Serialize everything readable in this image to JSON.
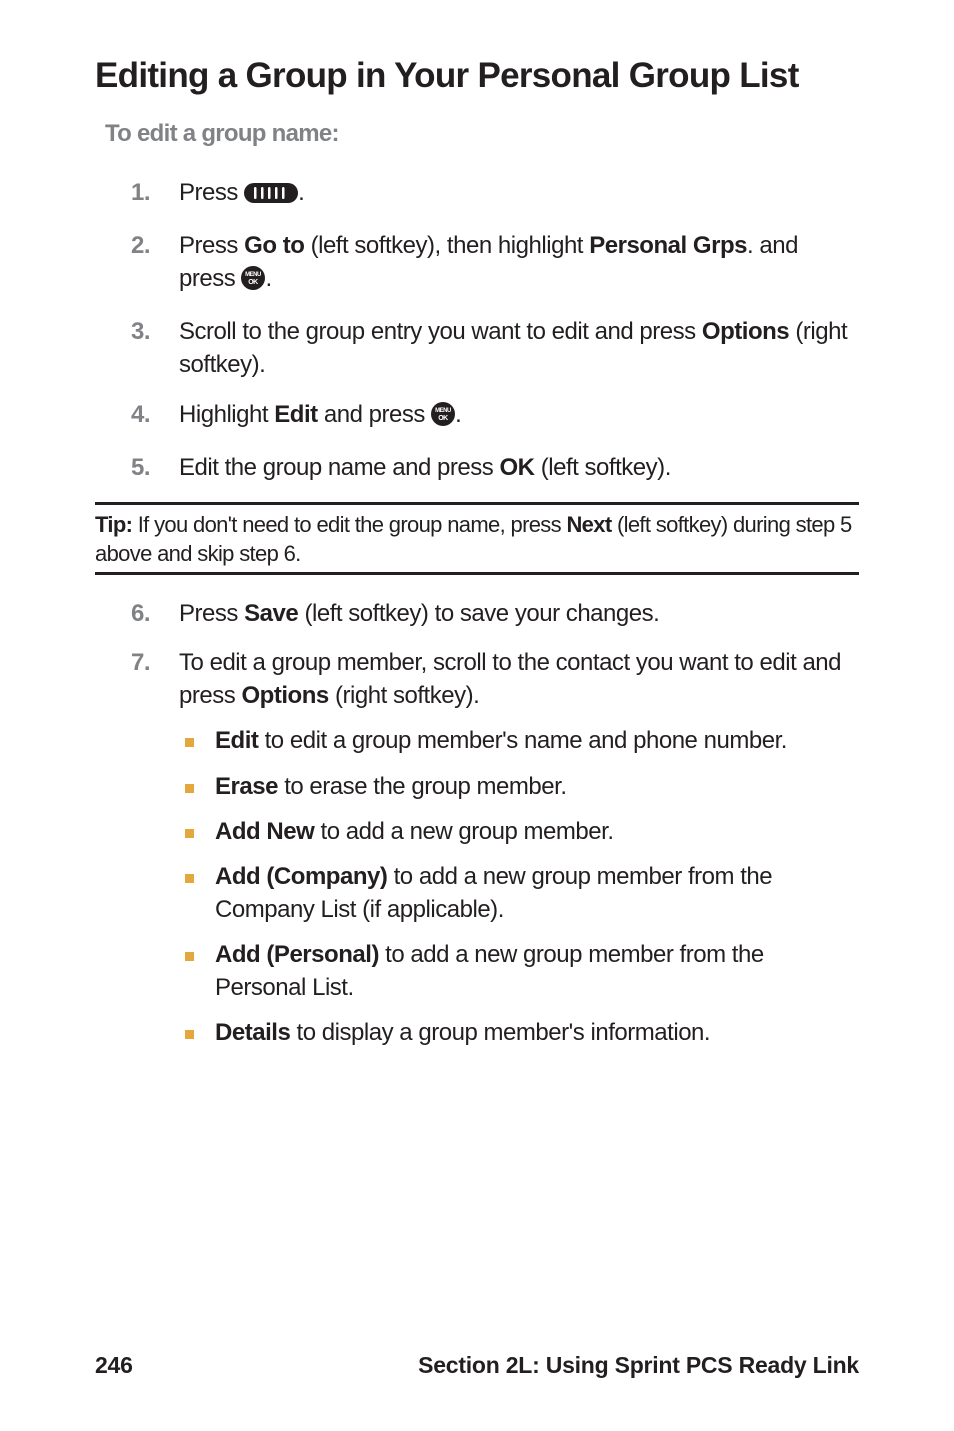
{
  "title": "Editing a Group in Your Personal Group List",
  "subheading": "To edit a group name:",
  "icons": {
    "walkie_talkie": "walkie-talkie-icon",
    "menu_ok": "menu-ok-icon"
  },
  "steps_part1": [
    {
      "num": "1.",
      "pre": "Press ",
      "icon": "walkie",
      "post": "."
    },
    {
      "num": "2.",
      "text": "Press ",
      "bold1": "Go to",
      "mid1": " (left softkey), then highlight ",
      "bold2": "Personal Grps",
      "mid2": ". and press ",
      "icon": "menu",
      "post": "."
    },
    {
      "num": "3.",
      "text": "Scroll to the group entry you want to edit and press ",
      "bold1": "Options",
      "mid1": " (right softkey)."
    },
    {
      "num": "4.",
      "text": "Highlight ",
      "bold1": "Edit",
      "mid1": " and press ",
      "icon": "menu",
      "post": "."
    },
    {
      "num": "5.",
      "text": "Edit the group name and press ",
      "bold1": "OK",
      "mid1": " (left softkey)."
    }
  ],
  "tip": {
    "label": "Tip: ",
    "text1": "If you don't need to edit the group name, press ",
    "bold": "Next",
    "text2": " (left softkey) during step 5 above and skip step 6."
  },
  "steps_part2": [
    {
      "num": "6.",
      "text": "Press ",
      "bold1": "Save",
      "mid1": " (left softkey) to save your changes."
    },
    {
      "num": "7.",
      "text": "To edit a group member, scroll to the contact you want to edit and press ",
      "bold1": "Options",
      "mid1": " (right softkey)."
    }
  ],
  "sub_items": [
    {
      "bold": "Edit",
      "text": " to edit a group member's name and phone number."
    },
    {
      "bold": "Erase",
      "text": " to erase the group member."
    },
    {
      "bold": "Add New",
      "text": " to add a new group member."
    },
    {
      "bold": "Add (Company)",
      "text": " to add a new group member from the Company List (if applicable)."
    },
    {
      "bold": "Add (Personal)",
      "text": " to add a new group member from the Personal List."
    },
    {
      "bold": "Details",
      "text": " to display a group member's information."
    }
  ],
  "footer": {
    "page": "246",
    "section": "Section 2L: Using Sprint PCS Ready Link"
  }
}
